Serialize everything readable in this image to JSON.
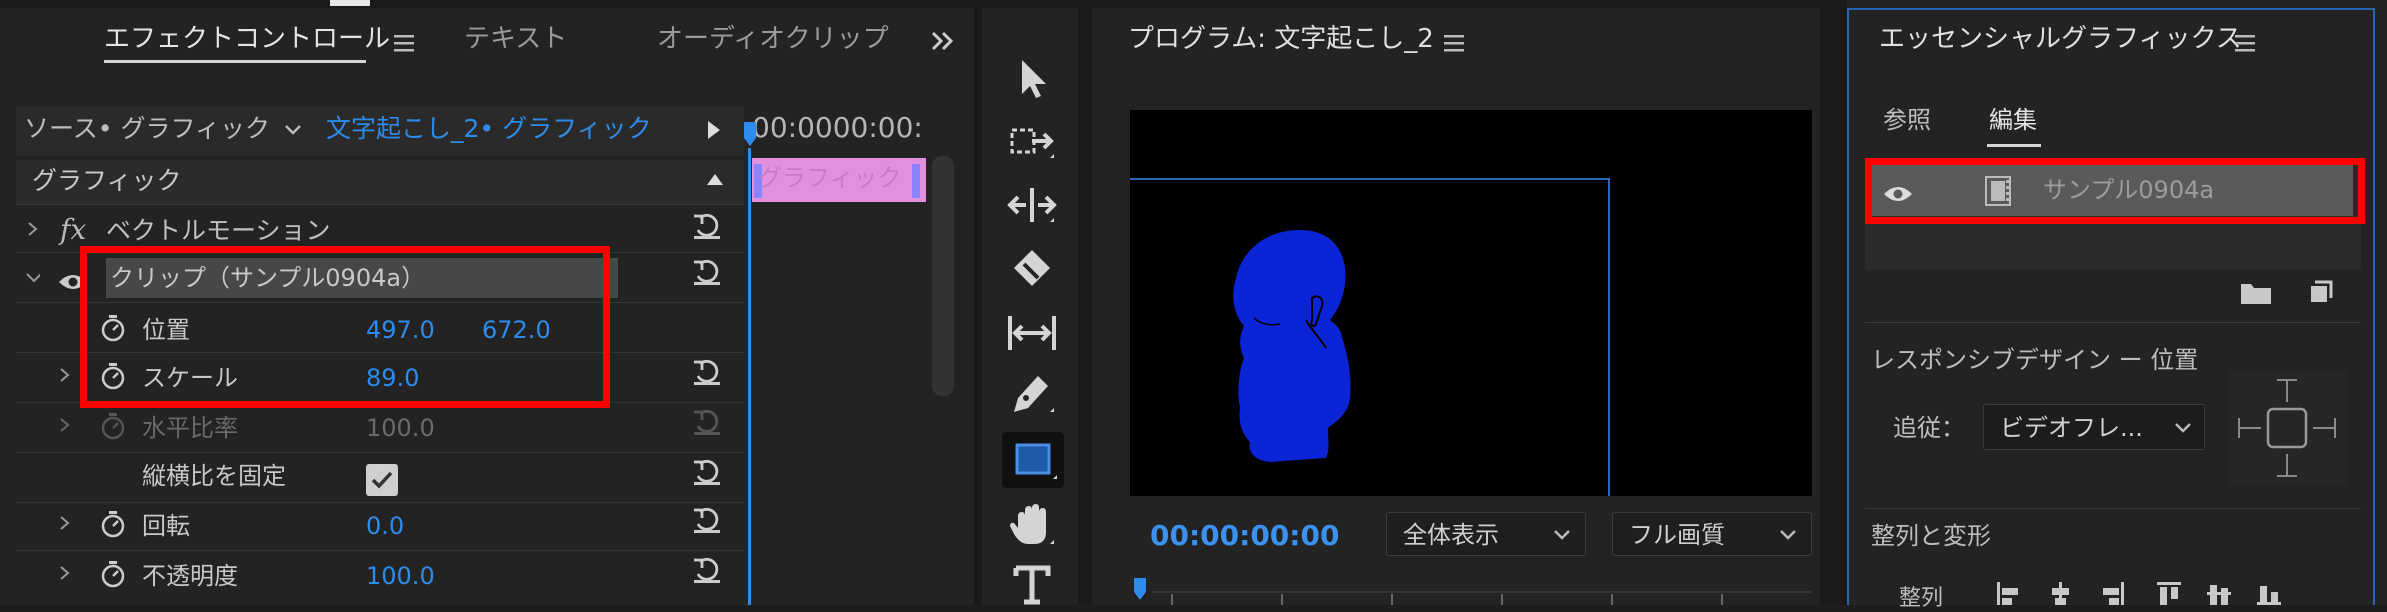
{
  "effect_panel": {
    "tabs": [
      {
        "label": "エフェクトコントロール",
        "active": true
      },
      {
        "label": "テキスト",
        "active": false
      },
      {
        "label": "オーディオクリップ",
        "active": false
      }
    ],
    "menu_icon": "hamburger-icon",
    "overflow_icon": "double-chevron-right-icon",
    "source_label": "ソース• グラフィック",
    "clip_selector": "文字起こし_2• グラフィック",
    "timecode": "00:0000:00:",
    "timeline_clip_label": "グラフィック",
    "section_label": "グラフィック",
    "vector_motion": "ベクトルモーション",
    "clip_label": "クリップ（サンプル0904a）",
    "properties": [
      {
        "label": "位置",
        "value1": "497.0",
        "value2": "672.0",
        "enabled": true
      },
      {
        "label": "スケール",
        "value1": "89.0",
        "value2": "",
        "enabled": true
      },
      {
        "label": "水平比率",
        "value1": "100.0",
        "value2": "",
        "enabled": false
      },
      {
        "label": "縦横比を固定",
        "value1": "",
        "value2": "",
        "enabled": true,
        "checkbox": true
      },
      {
        "label": "回転",
        "value1": "0.0",
        "value2": "",
        "enabled": true
      },
      {
        "label": "不透明度",
        "value1": "100.0",
        "value2": "",
        "enabled": true
      }
    ]
  },
  "tools": [
    "selection-tool-icon",
    "track-select-icon",
    "ripple-edit-icon",
    "razor-icon",
    "slip-icon",
    "pen-icon",
    "rectangle-icon",
    "hand-icon",
    "type-icon"
  ],
  "program": {
    "title": "プログラム: 文字起こし_2",
    "timecode": "00:00:00:00",
    "zoom": "全体表示",
    "quality": "フル画質",
    "silhouette_color": "#0a24d6"
  },
  "essential": {
    "title": "エッセンシャルグラフィックス",
    "tabs": [
      {
        "label": "参照",
        "active": false
      },
      {
        "label": "編集",
        "active": true
      }
    ],
    "layer_name": "サンプル0904a",
    "responsive_heading": "レスポンシブデザイン ー 位置",
    "follow_label": "追従：",
    "follow_value": "ビデオフレ...",
    "align_heading": "整列と変形",
    "align_label": "整列"
  },
  "colors": {
    "accent_blue": "#2d8ceb",
    "highlight_red": "#ff0000",
    "clip_pink": "#e28fe0"
  }
}
